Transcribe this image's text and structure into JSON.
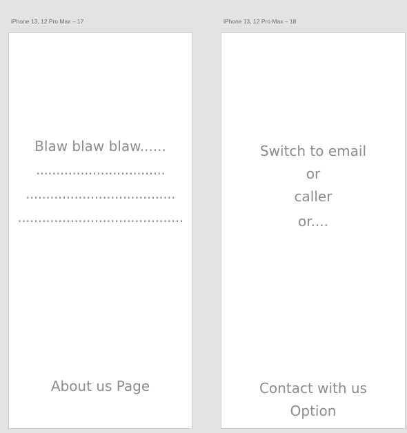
{
  "canvas": {
    "background": "#e3e3e3"
  },
  "artboards": [
    {
      "label": "iPhone 13, 12 Pro Max – 17",
      "lines": [
        "Blaw blaw blaw......",
        "................................",
        ".....................................",
        "........................................."
      ],
      "footer": "About us Page"
    },
    {
      "label": "iPhone 13, 12 Pro Max – 18",
      "lines": [
        "Switch to email",
        "or",
        "caller",
        "or...."
      ],
      "footer": [
        "Contact with us",
        "Option"
      ]
    }
  ],
  "colors": {
    "artboard_bg": "#ffffff",
    "text": "#8c8c8c",
    "label": "#6a6a6a"
  }
}
